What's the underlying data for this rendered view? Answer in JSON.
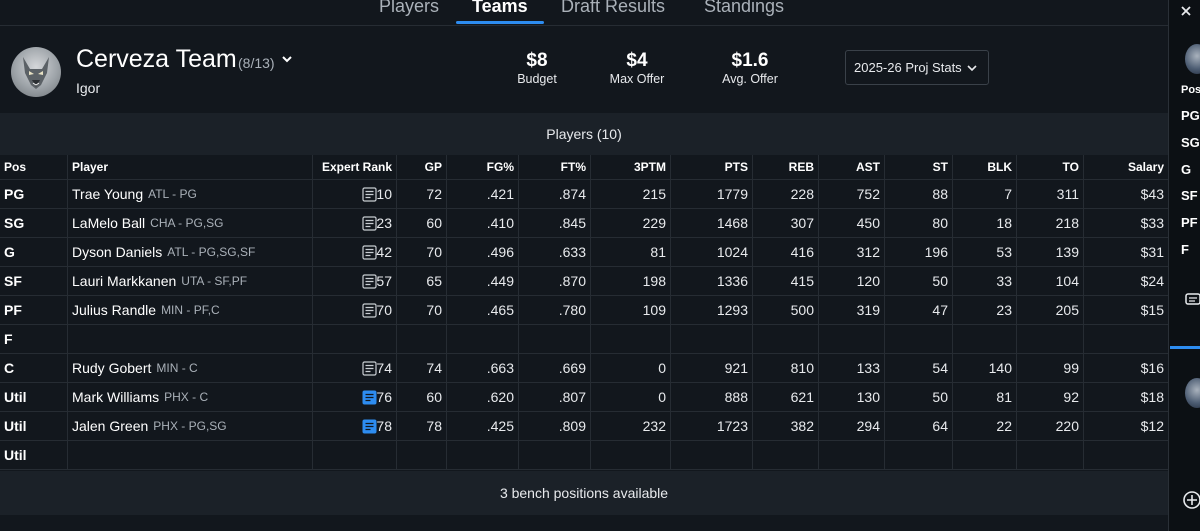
{
  "tabs": [
    {
      "label": "Players",
      "active": false
    },
    {
      "label": "Teams",
      "active": true
    },
    {
      "label": "Draft Results",
      "active": false
    },
    {
      "label": "Standings",
      "active": false
    }
  ],
  "team": {
    "name": "Cerveza Team",
    "count": "(8/13)",
    "owner": "Igor",
    "logo_icon": "wolf-logo-icon"
  },
  "stats": [
    {
      "value": "$8",
      "label": "Budget"
    },
    {
      "value": "$4",
      "label": "Max Offer"
    },
    {
      "value": "$1.6",
      "label": "Avg. Offer"
    }
  ],
  "proj_select": {
    "value": "2025-26 Proj Stats"
  },
  "players_title": "Players (10)",
  "columns": [
    "Pos",
    "Player",
    "Expert Rank",
    "GP",
    "FG%",
    "FT%",
    "3PTM",
    "PTS",
    "REB",
    "AST",
    "ST",
    "BLK",
    "TO",
    "Salary"
  ],
  "rows": [
    {
      "pos": "PG",
      "name": "Trae Young",
      "team": "ATL - PG",
      "note": "note-icon",
      "vals": [
        "10",
        "72",
        ".421",
        ".874",
        "215",
        "1779",
        "228",
        "752",
        "88",
        "7",
        "311",
        "$43"
      ]
    },
    {
      "pos": "SG",
      "name": "LaMelo Ball",
      "team": "CHA - PG,SG",
      "note": "note-icon",
      "vals": [
        "23",
        "60",
        ".410",
        ".845",
        "229",
        "1468",
        "307",
        "450",
        "80",
        "18",
        "218",
        "$33"
      ]
    },
    {
      "pos": "G",
      "name": "Dyson Daniels",
      "team": "ATL - PG,SG,SF",
      "note": "note-icon",
      "vals": [
        "42",
        "70",
        ".496",
        ".633",
        "81",
        "1024",
        "416",
        "312",
        "196",
        "53",
        "139",
        "$31"
      ]
    },
    {
      "pos": "SF",
      "name": "Lauri Markkanen",
      "team": "UTA - SF,PF",
      "note": "note-icon",
      "vals": [
        "57",
        "65",
        ".449",
        ".870",
        "198",
        "1336",
        "415",
        "120",
        "50",
        "33",
        "104",
        "$24"
      ]
    },
    {
      "pos": "PF",
      "name": "Julius Randle",
      "team": "MIN - PF,C",
      "note": "note-icon",
      "vals": [
        "70",
        "70",
        ".465",
        ".780",
        "109",
        "1293",
        "500",
        "319",
        "47",
        "23",
        "205",
        "$15"
      ]
    },
    {
      "pos": "F",
      "name": "",
      "team": "",
      "note": "",
      "vals": [
        "",
        "",
        "",
        "",
        "",
        "",
        "",
        "",
        "",
        "",
        "",
        ""
      ]
    },
    {
      "pos": "C",
      "name": "Rudy Gobert",
      "team": "MIN - C",
      "note": "note-icon",
      "vals": [
        "74",
        "74",
        ".663",
        ".669",
        "0",
        "921",
        "810",
        "133",
        "54",
        "140",
        "99",
        "$16"
      ]
    },
    {
      "pos": "Util",
      "name": "Mark Williams",
      "team": "PHX - C",
      "note": "note-filled-icon",
      "vals": [
        "76",
        "60",
        ".620",
        ".807",
        "0",
        "888",
        "621",
        "130",
        "50",
        "81",
        "92",
        "$18"
      ]
    },
    {
      "pos": "Util",
      "name": "Jalen Green",
      "team": "PHX - PG,SG",
      "note": "note-filled-icon",
      "vals": [
        "78",
        "78",
        ".425",
        ".809",
        "232",
        "1723",
        "382",
        "294",
        "64",
        "22",
        "220",
        "$12"
      ]
    },
    {
      "pos": "Util",
      "name": "",
      "team": "",
      "note": "",
      "vals": [
        "",
        "",
        "",
        "",
        "",
        "",
        "",
        "",
        "",
        "",
        "",
        ""
      ]
    }
  ],
  "bench_text": "3 bench positions available",
  "side_panel": {
    "header": "Pos",
    "positions": [
      "PG",
      "SG",
      "G",
      "SF",
      "PF",
      "F"
    ]
  },
  "colors": {
    "accent": "#2d8cf0",
    "background": "#12171d",
    "band": "#1b2128"
  }
}
